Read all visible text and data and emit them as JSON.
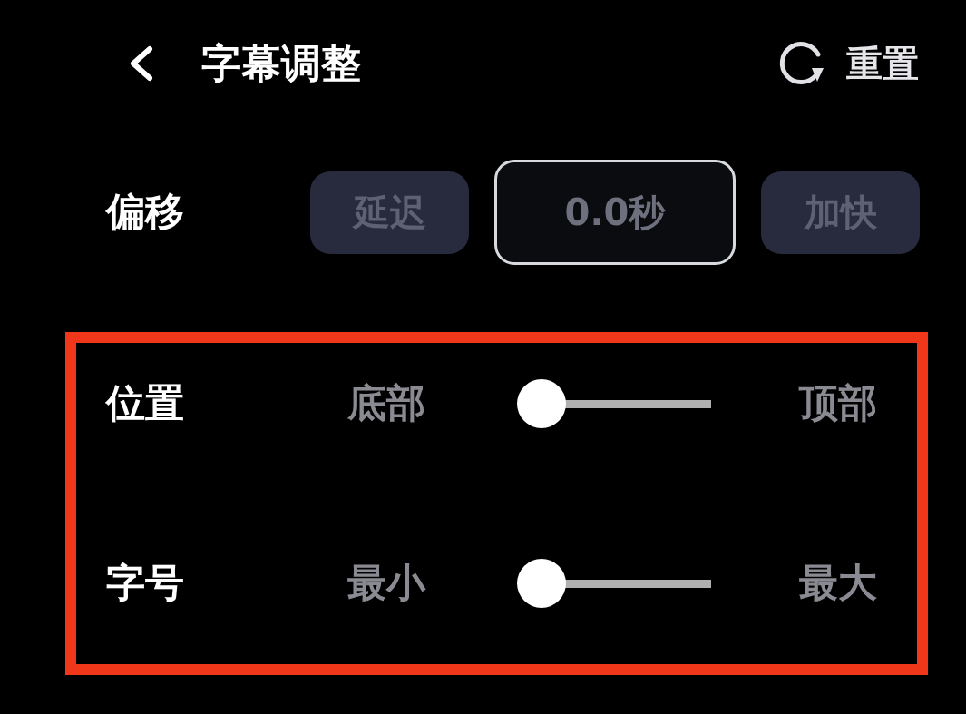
{
  "header": {
    "title": "字幕调整",
    "reset_button": {
      "label": "重置"
    }
  },
  "offset": {
    "label": "偏移",
    "decrease_button": "延迟",
    "value": "0.0秒",
    "increase_button": "加快"
  },
  "adjustments": {
    "highlighted": true,
    "sliders": [
      {
        "label": "位置",
        "min_label": "底部",
        "max_label": "顶部",
        "level": 0
      },
      {
        "label": "字号",
        "min_label": "最小",
        "max_label": "最大",
        "level": 0
      }
    ]
  }
}
